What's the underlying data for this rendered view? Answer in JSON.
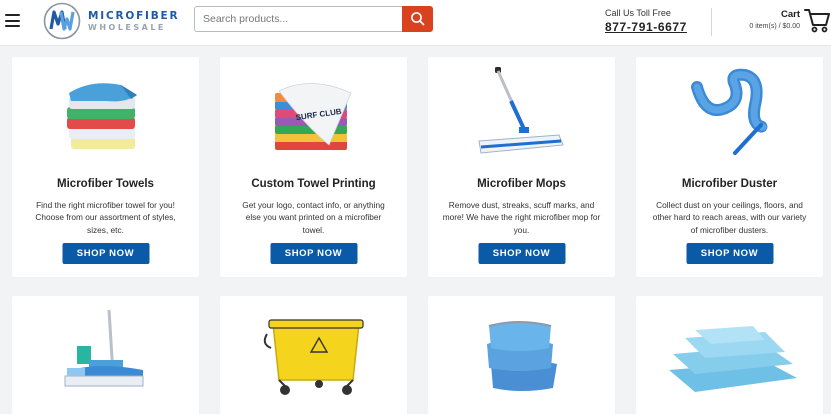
{
  "header": {
    "brand_line1": "MICROFIBER",
    "brand_line2": "WHOLESALE",
    "search_placeholder": "Search products...",
    "toll_label": "Call Us Toll Free",
    "toll_number": "877-791-6677",
    "cart_label": "Cart",
    "cart_summary": "0 item(s) / $0.00"
  },
  "colors": {
    "brand_blue": "#1f5aa6",
    "search_button": "#d9421f",
    "shop_button": "#0b5aa8"
  },
  "categories": [
    {
      "title": "Microfiber Towels",
      "description": "Find the right microfiber towel for you! Choose from our assortment of styles, sizes, etc.",
      "button": "SHOP NOW",
      "icon": "towel-stack-image"
    },
    {
      "title": "Custom Towel Printing",
      "description": "Get your logo, contact info, or anything else you want printed on a microfiber towel.",
      "button": "SHOP NOW",
      "icon": "printed-towel-image",
      "print_text": "SURF CLUB"
    },
    {
      "title": "Microfiber Mops",
      "description": "Remove dust, streaks, scuff marks, and more! We have the right microfiber mop for you.",
      "button": "SHOP NOW",
      "icon": "flat-mop-image"
    },
    {
      "title": "Microfiber Duster",
      "description": "Collect dust on your ceilings, floors, and other hard to reach areas, with our variety of microfiber dusters.",
      "button": "SHOP NOW",
      "icon": "duster-image"
    },
    {
      "icon": "mop-kit-image"
    },
    {
      "icon": "mop-bucket-image"
    },
    {
      "icon": "blue-towels-image"
    },
    {
      "icon": "glass-cloths-image"
    }
  ]
}
